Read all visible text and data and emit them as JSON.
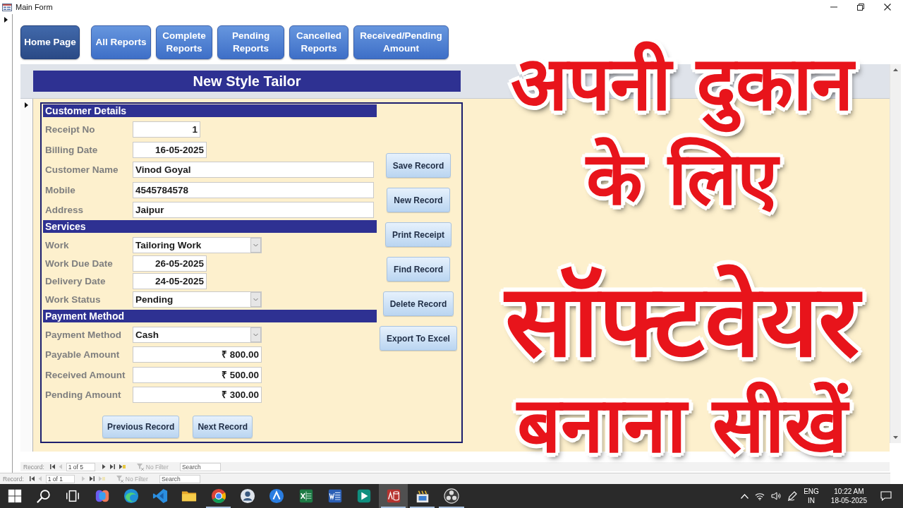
{
  "window": {
    "title": "Main Form"
  },
  "nav_buttons": [
    {
      "label": "Home Page",
      "selected": true
    },
    {
      "label": "All Reports",
      "selected": false
    },
    {
      "label": "Complete Reports",
      "selected": false
    },
    {
      "label": "Pending Reports",
      "selected": false
    },
    {
      "label": "Cancelled Reports",
      "selected": false
    },
    {
      "label": "Received/Pending Amount",
      "selected": false
    }
  ],
  "form": {
    "title": "New Style Tailor",
    "sections": [
      {
        "heading": "Customer Details",
        "fields": [
          {
            "label": "Receipt No",
            "value": "1",
            "kind": "number"
          },
          {
            "label": "Billing Date",
            "value": "16-05-2025",
            "kind": "date"
          },
          {
            "label": "Customer Name",
            "value": "Vinod Goyal",
            "kind": "text"
          },
          {
            "label": "Mobile",
            "value": "4545784578",
            "kind": "text"
          },
          {
            "label": "Address",
            "value": "Jaipur",
            "kind": "text"
          }
        ]
      },
      {
        "heading": "Services",
        "fields": [
          {
            "label": "Work",
            "value": "Tailoring Work",
            "kind": "combo"
          },
          {
            "label": "Work Due Date",
            "value": "26-05-2025",
            "kind": "date"
          },
          {
            "label": "Delivery Date",
            "value": "24-05-2025",
            "kind": "date"
          },
          {
            "label": "Work Status",
            "value": "Pending",
            "kind": "combo"
          }
        ]
      },
      {
        "heading": "Payment Method",
        "fields": [
          {
            "label": "Payment Method",
            "value": "Cash",
            "kind": "combo"
          },
          {
            "label": "Payable Amount",
            "value": "₹ 800.00",
            "kind": "currency"
          },
          {
            "label": "Received Amount",
            "value": "₹ 500.00",
            "kind": "currency"
          },
          {
            "label": "Pending Amount",
            "value": "₹ 300.00",
            "kind": "currency"
          }
        ]
      }
    ],
    "side_buttons": [
      "Save Record",
      "New Record",
      "Print Receipt",
      "Find Record",
      "Delete Record",
      "Export To Excel"
    ],
    "bottom_buttons": [
      "Previous Record",
      "Next Record"
    ]
  },
  "record_bars": [
    {
      "label": "Record:",
      "position": "1 of 5",
      "buttons": [
        {
          "kind": "first",
          "disabled": false
        },
        {
          "kind": "previous",
          "disabled": true
        },
        {
          "kind": "next",
          "disabled": false
        },
        {
          "kind": "last",
          "disabled": false
        },
        {
          "kind": "new",
          "disabled": false
        }
      ],
      "filter": "No Filter",
      "search_placeholder": "Search"
    },
    {
      "label": "Record:",
      "position": "1 of 1",
      "buttons": [
        {
          "kind": "first",
          "disabled": false
        },
        {
          "kind": "previous",
          "disabled": true
        },
        {
          "kind": "next",
          "disabled": true
        },
        {
          "kind": "last",
          "disabled": false
        },
        {
          "kind": "new",
          "disabled": true
        }
      ],
      "filter": "No Filter",
      "search_placeholder": "Search"
    }
  ],
  "headline": [
    "अपनी दुकान",
    "के लिए",
    "सॉफ्टवेयर",
    "बनाना सीखें"
  ],
  "taskbar": {
    "apps": [
      {
        "kind": "start",
        "running": false,
        "selected": false
      },
      {
        "kind": "search",
        "running": false,
        "selected": false
      },
      {
        "kind": "taskview",
        "running": false,
        "selected": false
      },
      {
        "kind": "swirl",
        "running": false,
        "selected": false
      },
      {
        "kind": "wave",
        "running": false,
        "selected": false
      },
      {
        "kind": "ribbon",
        "running": false,
        "selected": false
      },
      {
        "kind": "folder",
        "running": false,
        "selected": false
      },
      {
        "kind": "ball",
        "running": true,
        "selected": false
      },
      {
        "kind": "portrait",
        "running": false,
        "selected": false
      },
      {
        "kind": "triangle",
        "running": false,
        "selected": false
      },
      {
        "kind": "sheet",
        "running": false,
        "selected": false
      },
      {
        "kind": "doc",
        "running": false,
        "selected": false
      },
      {
        "kind": "play",
        "running": false,
        "selected": false
      },
      {
        "kind": "database",
        "running": true,
        "selected": true
      },
      {
        "kind": "clapper",
        "running": true,
        "selected": false
      },
      {
        "kind": "dots",
        "running": true,
        "selected": false
      }
    ],
    "tray": {
      "language": "ENG",
      "region": "IN",
      "time": "10:22 AM",
      "date": "18-05-2025"
    }
  }
}
